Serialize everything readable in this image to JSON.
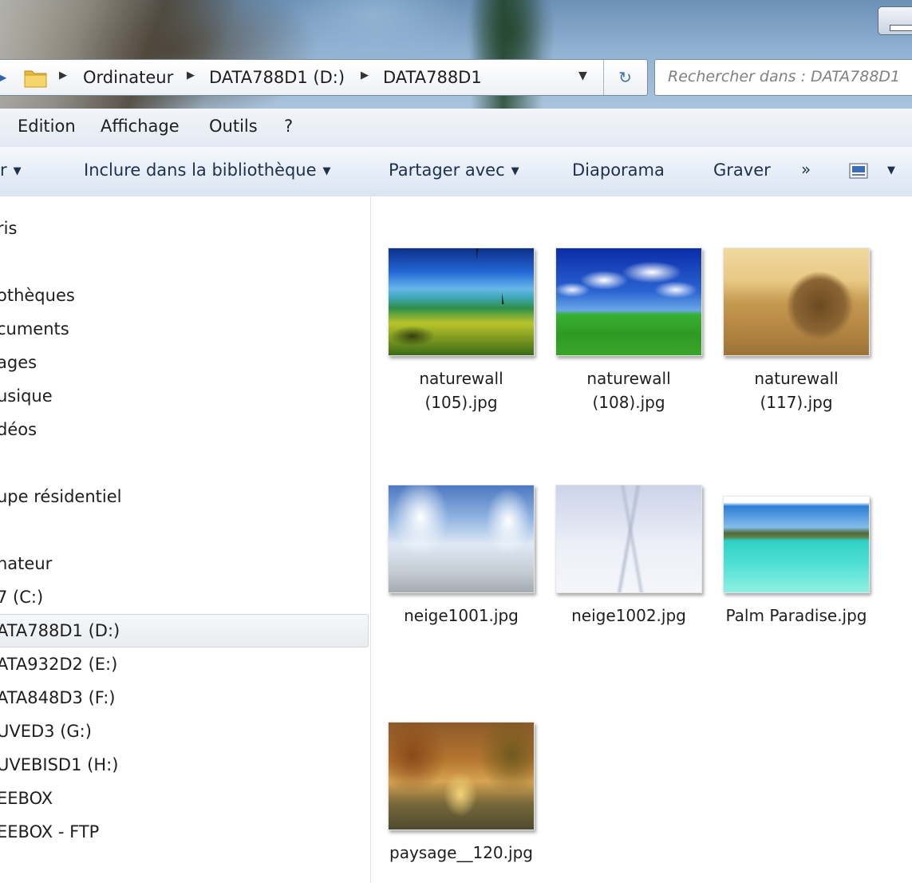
{
  "address": {
    "breadcrumbs": [
      "Ordinateur",
      "DATA788D1 (D:)",
      "DATA788D1"
    ],
    "separator": "▶",
    "dropdown_glyph": "▼",
    "refresh_glyph": "↻"
  },
  "search": {
    "placeholder": "Rechercher dans : DATA788D1"
  },
  "menu": {
    "items": [
      "Edition",
      "Affichage",
      "Outils",
      "?"
    ]
  },
  "commands": {
    "partial_first": "r",
    "include_library": "Inclure dans la bibliothèque",
    "share_with": "Partager avec",
    "slideshow": "Diaporama",
    "burn": "Graver",
    "more": "»",
    "caret": "▼"
  },
  "navigation": {
    "items": [
      {
        "label": "ris",
        "selected": false
      },
      {
        "label": "othèques",
        "selected": false
      },
      {
        "label": "cuments",
        "selected": false
      },
      {
        "label": "ages",
        "selected": false
      },
      {
        "label": "usique",
        "selected": false
      },
      {
        "label": "déos",
        "selected": false
      },
      {
        "label": "upe résidentiel",
        "selected": false
      },
      {
        "label": "nateur",
        "selected": false
      },
      {
        "label": "7 (C:)",
        "selected": false
      },
      {
        "label": "ATA788D1 (D:)",
        "selected": true
      },
      {
        "label": "ATA932D2 (E:)",
        "selected": false
      },
      {
        "label": "ATA848D3 (F:)",
        "selected": false
      },
      {
        "label": "UVED3 (G:)",
        "selected": false
      },
      {
        "label": "UVEBISD1 (H:)",
        "selected": false
      },
      {
        "label": "EEBOX",
        "selected": false
      },
      {
        "label": "EEBOX - FTP",
        "selected": false
      }
    ]
  },
  "files": [
    {
      "name_line1": "naturewall",
      "name_line2": "(105).jpg",
      "thumb": "tropical-beach-image"
    },
    {
      "name_line1": "naturewall",
      "name_line2": "(108).jpg",
      "thumb": "green-hill-sky-image"
    },
    {
      "name_line1": "naturewall",
      "name_line2": "(117).jpg",
      "thumb": "hay-bale-image"
    },
    {
      "name_line1": "neige1001.jpg",
      "name_line2": "",
      "thumb": "snowy-road-image"
    },
    {
      "name_line1": "neige1002.jpg",
      "name_line2": "",
      "thumb": "snow-field-image"
    },
    {
      "name_line1": "Palm Paradise.jpg",
      "name_line2": "",
      "thumb": "lagoon-image"
    },
    {
      "name_line1": "paysage__120.jpg",
      "name_line2": "",
      "thumb": "autumn-forest-image"
    }
  ],
  "colors": {
    "selection_bg": "#e9ecef",
    "command_text": "#1e3050",
    "accent_blue": "#2f64b5"
  }
}
